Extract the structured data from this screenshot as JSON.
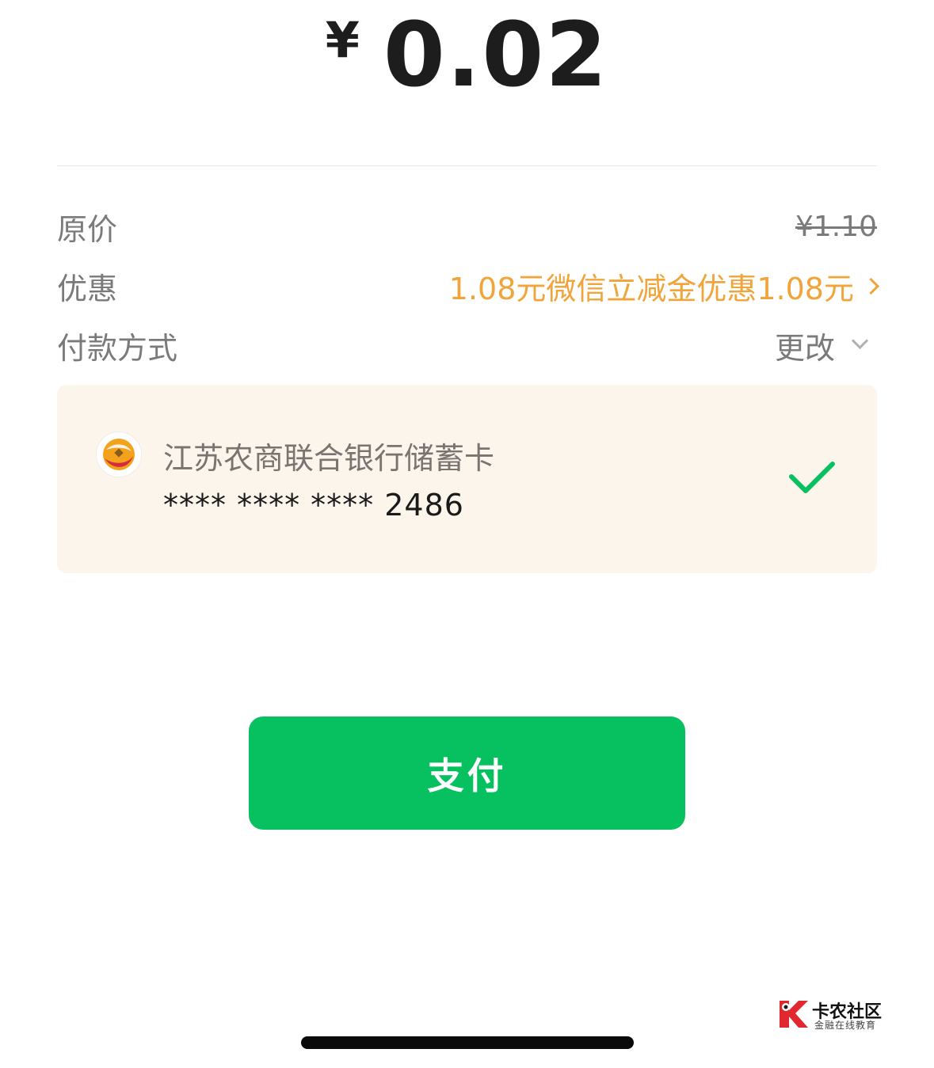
{
  "amount": {
    "currency": "¥",
    "value": "0.02"
  },
  "details": {
    "original_label": "原价",
    "original_value": "¥1.10",
    "discount_label": "优惠",
    "discount_value": "1.08元微信立减金优惠1.08元",
    "method_label": "付款方式",
    "change_label": "更改"
  },
  "card": {
    "bank_name": "江苏农商联合银行储蓄卡",
    "number": "**** **** **** 2486",
    "selected": true
  },
  "pay_button": {
    "label": "支付"
  },
  "watermark": {
    "title": "卡农社区",
    "subtitle": "金融在线教育"
  },
  "colors": {
    "accent_green": "#07c160",
    "discount_orange": "#f0a43a",
    "card_background": "#fcf5ec"
  },
  "icons": {
    "discount_arrow": "chevron-right-icon",
    "change_arrow": "chevron-down-icon",
    "selected_mark": "checkmark-icon",
    "bank_logo": "bank-logo-icon"
  }
}
